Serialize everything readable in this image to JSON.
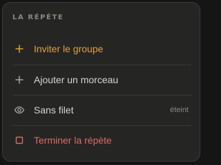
{
  "menu": {
    "title": "LA RÉPÉTE",
    "items": [
      {
        "label": "Inviter le groupe",
        "icon": "plus-icon",
        "color": "#e2a23a"
      },
      {
        "label": "Ajouter un morceau",
        "icon": "plus-icon",
        "color": "#d8d5cf"
      },
      {
        "label": "Sans filet",
        "icon": "eye-icon",
        "color": "#d8d5cf",
        "state": "éteint"
      },
      {
        "label": "Terminer la répète",
        "icon": "stop-square-icon",
        "color": "#de6b63"
      }
    ]
  },
  "colors": {
    "background": "#151515",
    "panel": "#252524",
    "accent_yellow": "#e2a23a",
    "danger_red": "#de6b63",
    "muted": "#8b8883"
  }
}
